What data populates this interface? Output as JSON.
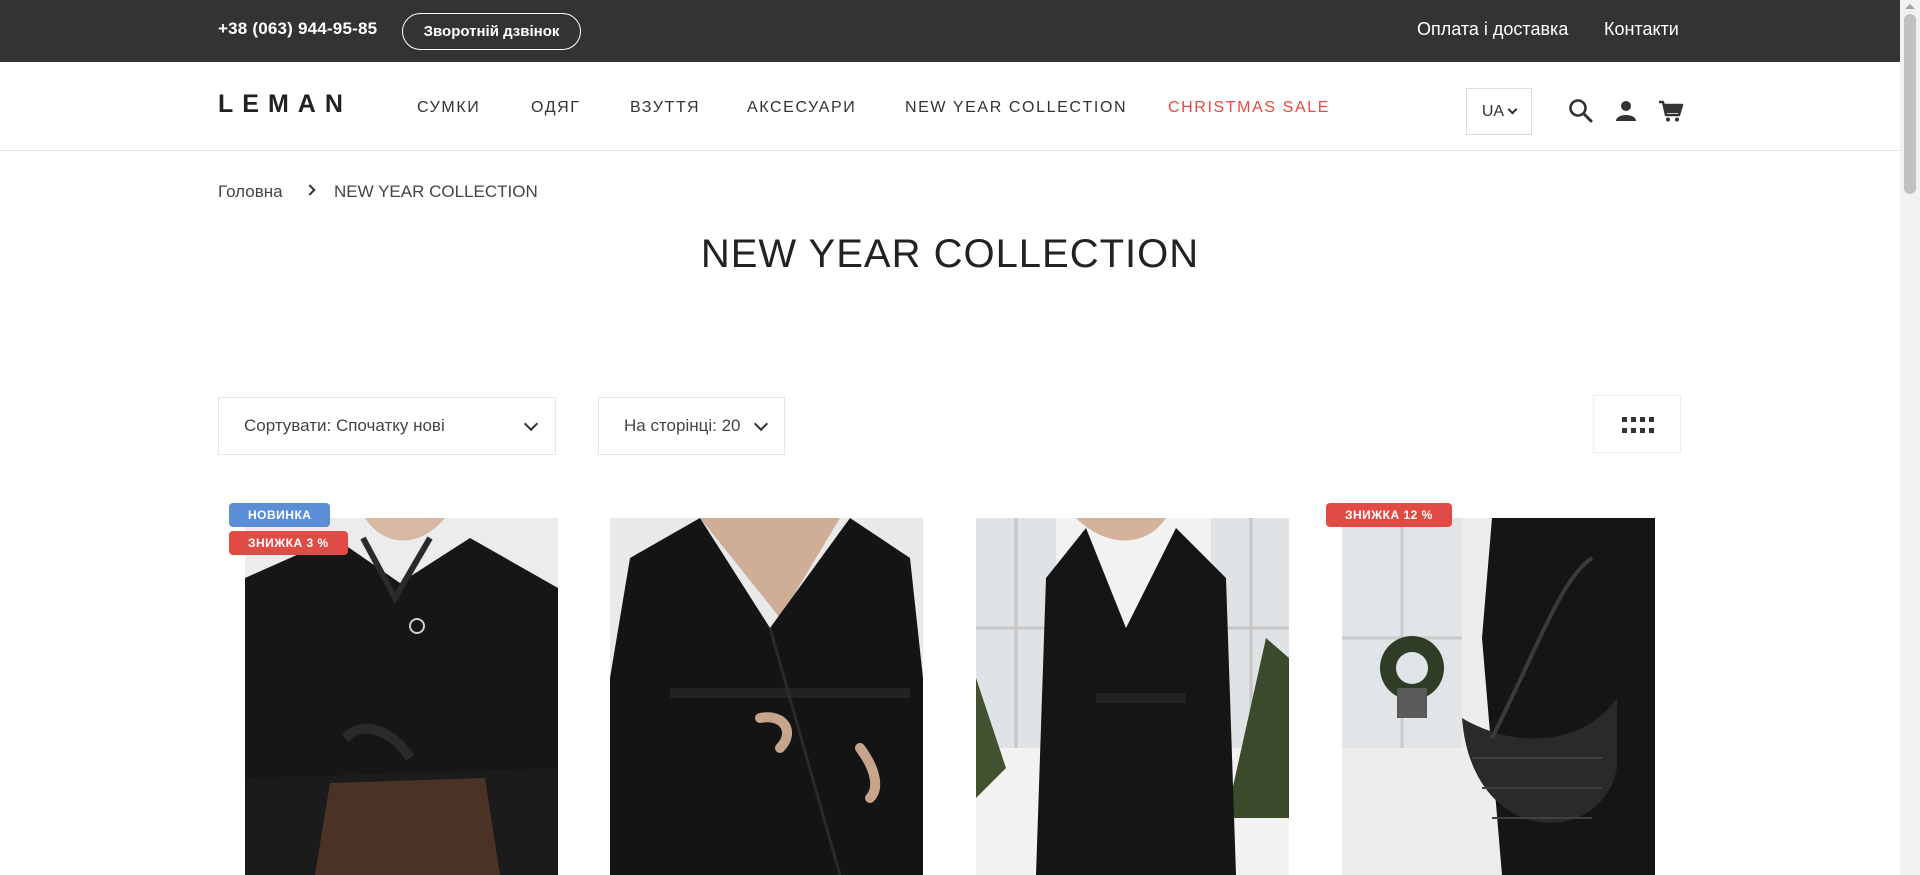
{
  "topbar": {
    "phone": "+38 (063) 944-95-85",
    "callback_label": "Зворотній дзвінок",
    "links": [
      "Оплата і доставка",
      "Контакти"
    ]
  },
  "header": {
    "logo": "LEMAN",
    "nav": [
      "СУМКИ",
      "ОДЯГ",
      "ВЗУТТЯ",
      "АКСЕСУАРИ",
      "NEW YEAR COLLECTION",
      "CHRISTMAS SALE"
    ],
    "lang": "UA",
    "icons": [
      "search-icon",
      "user-icon",
      "cart-icon"
    ]
  },
  "breadcrumb": {
    "home": "Головна",
    "current": "NEW YEAR COLLECTION"
  },
  "page_title": "NEW YEAR COLLECTION",
  "controls": {
    "sort_label": "Сортувати: Спочатку нові",
    "per_page_label": "На сторінці: 20"
  },
  "products": [
    {
      "badges": [
        {
          "text": "НОВИНКА",
          "type": "new"
        },
        {
          "text": "ЗНИЖКА 3 %",
          "type": "sale"
        }
      ]
    },
    {
      "badges": []
    },
    {
      "badges": []
    },
    {
      "badges": [
        {
          "text": "ЗНИЖКА 12 %",
          "type": "sale"
        }
      ]
    }
  ],
  "colors": {
    "topbar": "#333333",
    "sale_accent": "#e8493f",
    "badge_new": "#5b8ed6",
    "badge_sale": "#e04c45"
  }
}
